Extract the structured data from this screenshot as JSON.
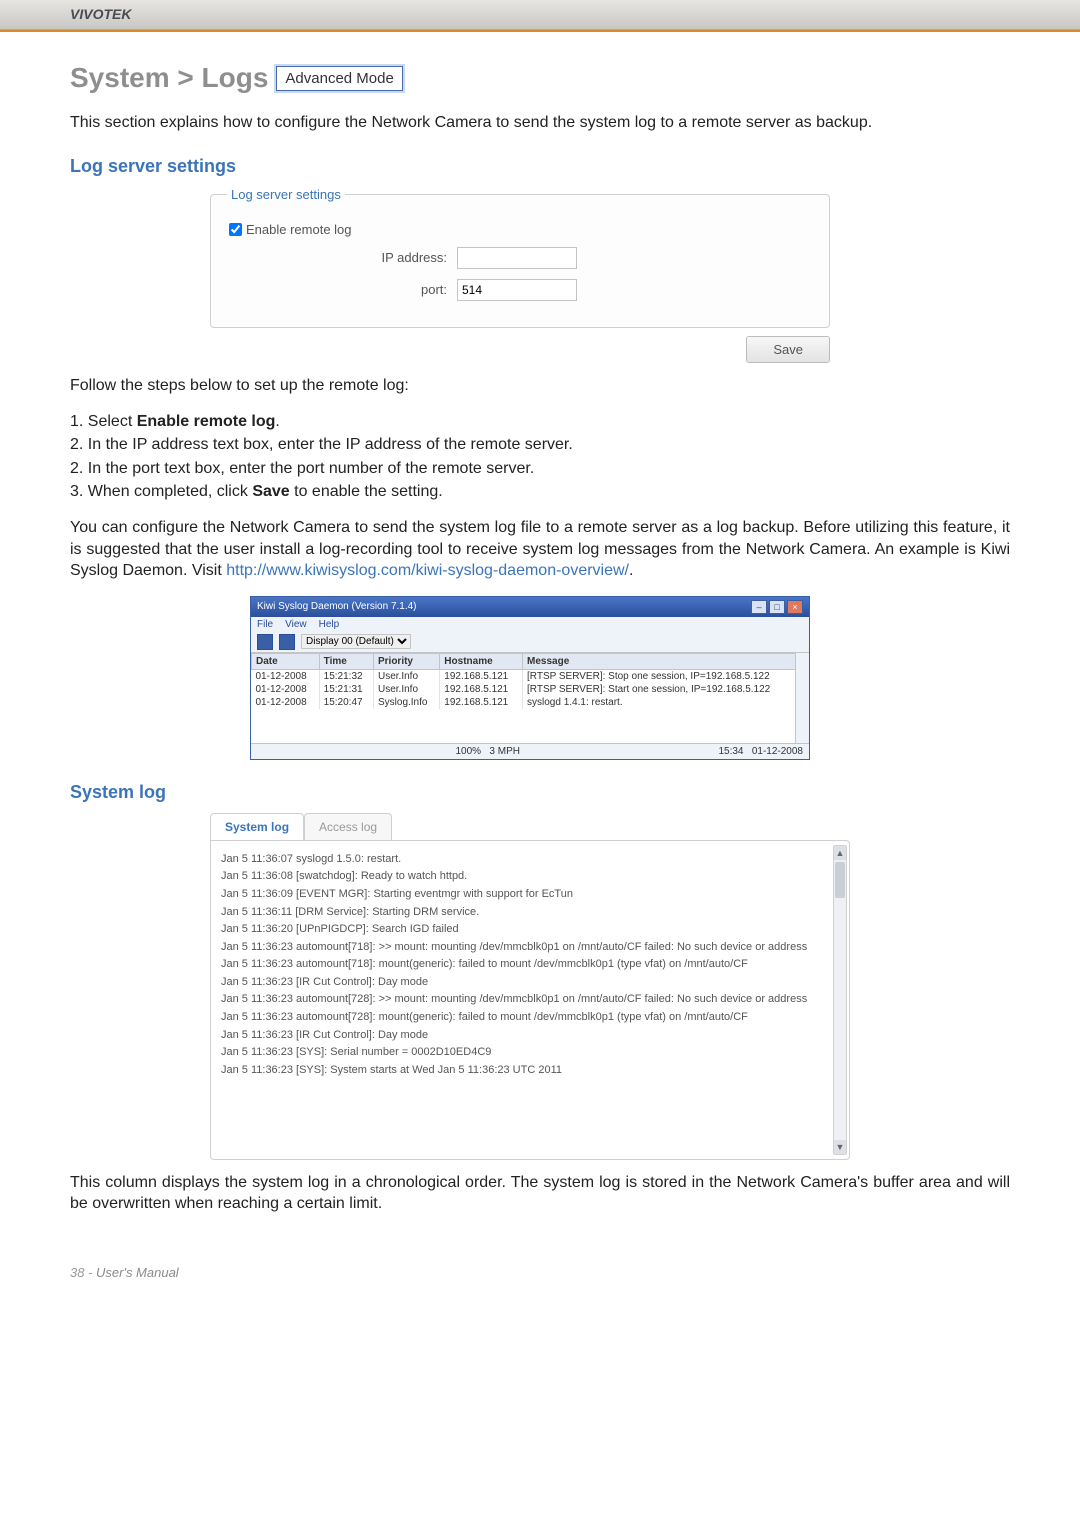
{
  "brand": "VIVOTEK",
  "breadcrumb": "System > Logs",
  "badge": "Advanced Mode",
  "intro": "This section explains how to configure the Network Camera to send the system log to a remote server as backup.",
  "sections": {
    "log_server": "Log server settings",
    "system_log": "System log"
  },
  "log_server_panel": {
    "legend": "Log server settings",
    "enable_label": "Enable remote log",
    "ip_label": "IP address:",
    "ip_value": "",
    "port_label": "port:",
    "port_value": "514",
    "save_label": "Save"
  },
  "follow_text": "Follow the steps below to set up the remote log:",
  "steps": [
    {
      "n": "1.",
      "pre": "Select ",
      "bold": "Enable remote log",
      "post": "."
    },
    {
      "n": "2.",
      "pre": "In the IP address text box, enter the IP address of the remote server.",
      "bold": "",
      "post": ""
    },
    {
      "n": "2.",
      "pre": "In the port text box, enter the port number of the remote server.",
      "bold": "",
      "post": ""
    },
    {
      "n": "3.",
      "pre": "When completed, click ",
      "bold": "Save",
      "post": " to enable the setting."
    }
  ],
  "para2a": "You can configure the Network Camera to send the system log file to a remote server as a log backup. Before utilizing this feature, it is suggested that the user install a log-recording tool to receive system log messages from the Network Camera. An example is Kiwi Syslog Daemon. Visit ",
  "para2_link": "http://www.kiwisyslog.com/kiwi-syslog-daemon-overview/",
  "para2b": ".",
  "kiwi": {
    "title": "Kiwi Syslog Daemon (Version 7.1.4)",
    "menus": [
      "File",
      "View",
      "Help"
    ],
    "display_label": "Display 00 (Default)",
    "columns": [
      "Date",
      "Time",
      "Priority",
      "Hostname",
      "Message"
    ],
    "rows": [
      {
        "date": "01-12-2008",
        "time": "15:21:32",
        "priority": "User.Info",
        "hostname": "192.168.5.121",
        "message": "[RTSP SERVER]: Stop one session, IP=192.168.5.122"
      },
      {
        "date": "01-12-2008",
        "time": "15:21:31",
        "priority": "User.Info",
        "hostname": "192.168.5.121",
        "message": "[RTSP SERVER]: Start one session, IP=192.168.5.122"
      },
      {
        "date": "01-12-2008",
        "time": "15:20:47",
        "priority": "Syslog.Info",
        "hostname": "192.168.5.121",
        "message": "syslogd 1.4.1: restart."
      }
    ],
    "status_left": "100%",
    "status_mid": "3 MPH",
    "status_right_time": "15:34",
    "status_right_date": "01-12-2008"
  },
  "syslog": {
    "tabs": {
      "active": "System log",
      "other": "Access log"
    },
    "lines": [
      "Jan 5 11:36:07 syslogd 1.5.0: restart.",
      "Jan 5 11:36:08 [swatchdog]: Ready to watch httpd.",
      "Jan 5 11:36:09 [EVENT MGR]: Starting eventmgr with support for EcTun",
      "Jan 5 11:36:11 [DRM Service]: Starting DRM service.",
      "Jan 5 11:36:20 [UPnPIGDCP]: Search IGD failed",
      "Jan 5 11:36:23 automount[718]: >> mount: mounting /dev/mmcblk0p1 on /mnt/auto/CF failed: No such device or address",
      "Jan 5 11:36:23 automount[718]: mount(generic): failed to mount /dev/mmcblk0p1 (type vfat) on /mnt/auto/CF",
      "Jan 5 11:36:23 [IR Cut Control]: Day mode",
      "Jan 5 11:36:23 automount[728]: >> mount: mounting /dev/mmcblk0p1 on /mnt/auto/CF failed: No such device or address",
      "Jan 5 11:36:23 automount[728]: mount(generic): failed to mount /dev/mmcblk0p1 (type vfat) on /mnt/auto/CF",
      "Jan 5 11:36:23 [IR Cut Control]: Day mode",
      "Jan 5 11:36:23 [SYS]: Serial number = 0002D10ED4C9",
      "Jan 5 11:36:23 [SYS]: System starts at Wed Jan 5 11:36:23 UTC 2011"
    ]
  },
  "closing": "This column displays the system log in a chronological order. The system log is stored in the Network Camera's buffer area and will be overwritten when reaching a certain limit.",
  "footer_page": "38 - ",
  "footer_label": "User's Manual"
}
